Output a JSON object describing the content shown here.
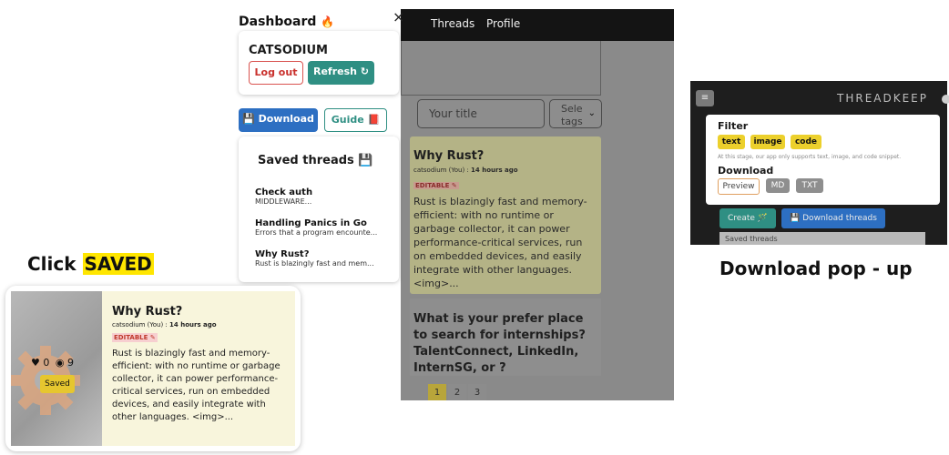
{
  "app": {
    "nav": [
      "Threads",
      "Profile"
    ],
    "title_placeholder": "Your title",
    "tags_select": [
      "Sele",
      "tags"
    ],
    "card1": {
      "title": "Why Rust?",
      "author": "catsodium (You) : ",
      "time": "14 hours ago",
      "badge": "EDITABLE ✎",
      "text": "Rust is blazingly fast and memory-efficient: with no runtime or garbage collector, it can power performance-critical services, run on embedded devices, and easily integrate with other languages. <img>..."
    },
    "card2": {
      "title": "What is your prefer place to search for internships? TalentConnect, LinkedIn, InternSG, or ?"
    },
    "pages": [
      "1",
      "2",
      "3"
    ],
    "active_page": "1"
  },
  "dashboard": {
    "title": "Dashboard",
    "title_icon": "🔥",
    "close": "×",
    "username": "CATSODIUM",
    "logout_label": "Log out",
    "refresh_label": "Refresh ↻",
    "download_label": "💾 Download",
    "guide_label": "Guide 📕",
    "saved_heading": "Saved threads 💾",
    "saved": [
      {
        "title": "Check auth",
        "preview": "MIDDLEWARE..."
      },
      {
        "title": "Handling Panics in Go",
        "preview": "Errors that a program encounte..."
      },
      {
        "title": "Why Rust?",
        "preview": "Rust is blazingly fast and mem..."
      }
    ]
  },
  "left_card": {
    "click_prefix": "Click ",
    "click_highlight": "SAVED",
    "likes": "0",
    "views": "9",
    "saved_label": "Saved",
    "title": "Why Rust?",
    "author": "catsodium (You) : ",
    "time": "14 hours ago",
    "badge": "EDITABLE ✎",
    "text": "Rust is blazingly fast and memory-efficient: with no runtime or garbage collector, it can power performance-critical services, run on embedded devices, and easily integrate with other languages. <img>..."
  },
  "popup": {
    "brand": "THREADKEEP",
    "filter_heading": "Filter",
    "filters": [
      "text",
      "image",
      "code"
    ],
    "note": "At this stage, our app only supports text, image, and code snippet.",
    "download_heading": "Download",
    "download_options": [
      "Preview",
      "MD",
      "TXT"
    ],
    "create_label": "Create 🪄",
    "download_threads_label": "💾 Download threads",
    "saved_threads_label": "Saved threads",
    "caption": "Download pop - up"
  }
}
